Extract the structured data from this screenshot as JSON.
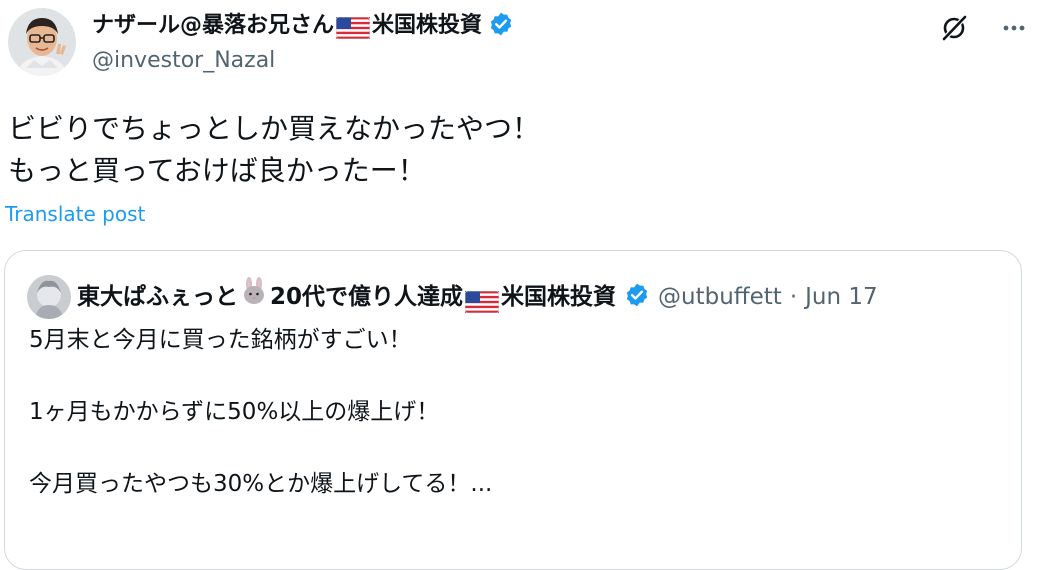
{
  "author": {
    "display_name_pre": "ナザール@暴落お兄さん",
    "display_name_post": "米国株投資",
    "handle": "@investor_Nazal",
    "flag_icon": "us-flag-icon",
    "verified_icon": "verified-badge-icon"
  },
  "top_actions": {
    "grok_icon": "grok-icon",
    "more_icon": "more-horizontal-icon",
    "more_label": "···"
  },
  "post": {
    "line1": "ビビりでちょっとしか買えなかったやつ！",
    "line2": "もっと買っておけば良かったー！",
    "translate_label": "Translate post"
  },
  "quote": {
    "name_part1": "東大ぱふぇっと",
    "name_part2": "20代で億り人達成",
    "name_part3": "米国株投資",
    "rabbit_icon": "rabbit-icon",
    "handle": "@utbuffett",
    "separator": "·",
    "date": "Jun 17",
    "line1": "5月末と今月に買った銘柄がすごい！",
    "line2": "1ヶ月もかからずに50%以上の爆上げ！",
    "line3": "今月買ったやつも30%とか爆上げしてる！..."
  },
  "colors": {
    "text": "#0f1419",
    "secondary": "#536471",
    "link": "#1d9bf0",
    "border": "#cfd9de",
    "verified": "#1d9bf0"
  }
}
